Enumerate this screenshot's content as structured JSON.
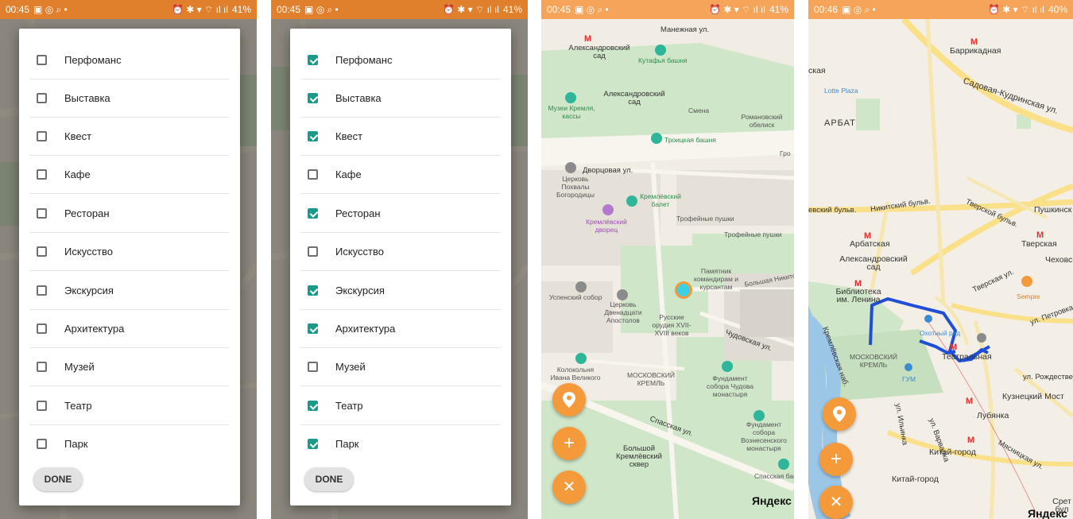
{
  "panel1": {
    "status": {
      "time": "00:45",
      "battery": "41%"
    },
    "items": [
      {
        "label": "Перфоманс",
        "checked": false
      },
      {
        "label": "Выставка",
        "checked": false
      },
      {
        "label": "Квест",
        "checked": false
      },
      {
        "label": "Кафе",
        "checked": false
      },
      {
        "label": "Ресторан",
        "checked": false
      },
      {
        "label": "Искусство",
        "checked": false
      },
      {
        "label": "Экскурсия",
        "checked": false
      },
      {
        "label": "Архитектура",
        "checked": false
      },
      {
        "label": "Музей",
        "checked": false
      },
      {
        "label": "Театр",
        "checked": false
      },
      {
        "label": "Парк",
        "checked": false
      }
    ],
    "done_label": "DONE"
  },
  "panel2": {
    "status": {
      "time": "00:45",
      "battery": "41%"
    },
    "items": [
      {
        "label": "Перфоманс",
        "checked": true
      },
      {
        "label": "Выставка",
        "checked": true
      },
      {
        "label": "Квест",
        "checked": true
      },
      {
        "label": "Кафе",
        "checked": false
      },
      {
        "label": "Ресторан",
        "checked": true
      },
      {
        "label": "Искусство",
        "checked": false
      },
      {
        "label": "Экскурсия",
        "checked": true
      },
      {
        "label": "Архитектура",
        "checked": true
      },
      {
        "label": "Музей",
        "checked": false
      },
      {
        "label": "Театр",
        "checked": true
      },
      {
        "label": "Парк",
        "checked": true
      }
    ],
    "done_label": "DONE"
  },
  "panel3": {
    "status": {
      "time": "00:45",
      "battery": "41%"
    },
    "map_labels": {
      "manezhnaya": "Манежная ул.",
      "alex_garden": "Александровский сад",
      "alex_garden2": "Александровский сад",
      "kutafya": "Кутафья башня",
      "museums": "Музеи Кремля, кассы",
      "smena": "Смена",
      "romanovsky": "Романовский обелиск",
      "troitskaya": "Троицкая башня",
      "dvortsovaya": "Дворцовая ул.",
      "church_pokhvaly": "Церковь Похвалы Богородицы",
      "kremlin_ballet": "Кремлёвский балет",
      "kremlin_palace": "Кремлёвский дворец",
      "trophy1": "Трофейные пушки",
      "trophy2": "Трофейные пушки",
      "monument": "Памятник командирам и курсантам",
      "bolshaya_nik": "Большая Никитская",
      "uspensky": "Успенский собор",
      "apostles": "Церковь Двенадцати Апостолов",
      "russian_guns": "Русские орудия XVII-XVIII веков",
      "chudovskaya": "Чудовская ул.",
      "bell_tower": "Колокольня Ивана Великого",
      "moscow_kremlin": "МОСКОВСКИЙ КРЕМЛЬ",
      "chudov": "Фундамент собора Чудова монастыря",
      "voznesensky": "Фундамент собора Вознесенского монастыря",
      "spasskaya": "Спасская ул.",
      "spasskaya_tower": "Спасская башня",
      "big_square": "Большой Кремлёвский сквер",
      "gro": "Гро"
    },
    "logo": "Яндекс",
    "fab_icons": [
      "location-pin-icon",
      "plus-icon",
      "close-icon"
    ]
  },
  "panel4": {
    "status": {
      "time": "00:46",
      "battery": "40%"
    },
    "map_labels": {
      "barrikadnaya": "Баррикадная",
      "kaya": "ская",
      "lotte": "Lotte Plaza",
      "arbat": "АРБАТ",
      "sadovaya": "Садовая-Кудринская ул.",
      "nikitsky": "Никитский бульв.",
      "vsky_bulv": "евский бульв.",
      "tverskoy": "Тверской бульв.",
      "pushkinsk": "Пушкинск",
      "arbatskaya": "Арбатская",
      "alex_garden": "Александровский сад",
      "tverskaya": "Тверская",
      "chekhov": "Чеховск",
      "tverskaya_ul": "Тверская ул.",
      "library": "Библиотека им. Ленина",
      "sempre": "Sempre",
      "petrovka": "ул. Петровка",
      "okhotny": "Охотный ряд",
      "kremlin": "МОСКОВСКИЙ КРЕМЛЬ",
      "teatralnaya": "Театральная",
      "gum": "ГУМ",
      "rozhdestv": "ул. Рождествен",
      "kuznetsky": "Кузнецкий Мост",
      "lubyanka": "Лубянка",
      "kremlin_nab": "Кремлёвская наб.",
      "ilyinka": "ул. Ильинка",
      "varvarka": "ул. Варварка",
      "myasnitskaya": "Мясницкая ул.",
      "kitay1": "Китай-город",
      "kitay2": "Китай-город",
      "sret": "Срет бул"
    },
    "logo": "Яндекс",
    "fab_icons": [
      "location-pin-icon",
      "plus-icon",
      "close-icon"
    ]
  },
  "colors": {
    "status_bar": "#e07f2c",
    "checkbox_checked": "#1a9b8a",
    "fab": "#f59a3b",
    "route": "#1f4fd6",
    "user_location": "#3ad1e6"
  }
}
